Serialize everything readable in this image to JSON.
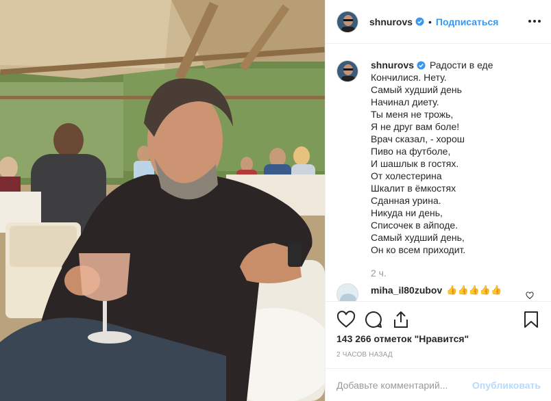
{
  "header": {
    "username": "shnurovs",
    "follow_label": "Подписаться",
    "separator": "•"
  },
  "caption": {
    "username": "shnurovs",
    "first_line": "Радости в еде",
    "lines": [
      "Кончилися. Нету.",
      "Самый худший день",
      "Начинал диету.",
      "Ты меня не трожь,",
      "Я не друг вам боле!",
      "Врач сказал, - хорош",
      "Пиво на футболе,",
      "И шашлык в гостях.",
      "От холестерина",
      "Шкалит в ёмкостях",
      "Сданная урина.",
      "Никуда ни день,",
      "Списочек в айподе.",
      "Самый худший день,",
      "Он ко всем приходит."
    ],
    "time_ago": "2 ч."
  },
  "comment": {
    "username": "miha_il80zubov",
    "text": "👍👍👍👍👍"
  },
  "likes_text": "143 266 отметок \"Нравится\"",
  "date_text": "2 ЧАСОВ НАЗАД",
  "add_comment": {
    "placeholder": "Добавьте комментарий...",
    "publish_label": "Опубликовать"
  },
  "colors": {
    "accent": "#3897f0",
    "publish_disabled": "#b3dbff",
    "muted": "#999999",
    "verified": "#3897f0"
  },
  "icons": [
    "more-icon",
    "verified-icon",
    "heart-icon",
    "comment-icon",
    "share-icon",
    "bookmark-icon"
  ]
}
